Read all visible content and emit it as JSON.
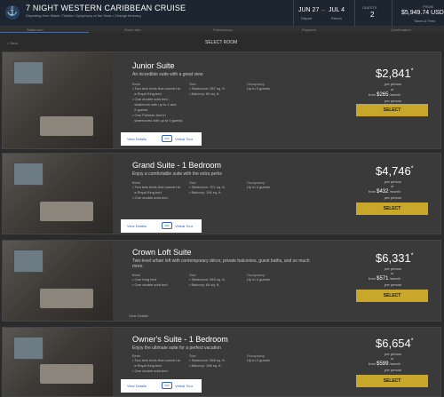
{
  "header": {
    "title": "7 NIGHT WESTERN CARIBBEAN CRUISE",
    "subtitle": "Departing from Miami, Florida • Symphony of the Seas • Change Itinerary",
    "depart_date": "JUN 27",
    "return_date": "JUL 4",
    "depart_label": "Depart",
    "return_label": "Return",
    "guests_label": "GUESTS",
    "guests_value": "2",
    "price_label": "FROM",
    "price_value": "$5,949.74 USD",
    "price_note": "Taxes & Fees"
  },
  "steps": [
    "Stateroom",
    "Room Info",
    "Preferences",
    "Payment",
    "Confirmation"
  ],
  "nav": {
    "back": "< Back",
    "page_title": "SELECT ROOM"
  },
  "labels": {
    "beds": "Beds",
    "size": "Size",
    "occupancy": "Occupancy",
    "view_details": "View Details",
    "virtual_tour": "Virtual Tour",
    "select": "SELECT",
    "or": "or",
    "from": "from",
    "month": "/month",
    "per_person": "per person"
  },
  "rooms": [
    {
      "name": "Junior Suite",
      "desc": "An incredible suite with a great view",
      "beds": [
        "Two twin beds that convert to",
        "a Royal King bed",
        "One double sofa bed -",
        "stateroom with up to 4 and",
        "5 guests",
        "One Pullman bed in",
        "staterooms with up to 5 guests"
      ],
      "size": [
        "Stateroom: 287 sq. ft.",
        "Balcony: 80 sq. ft."
      ],
      "occupancy": "Up to 5 guests",
      "price": "$2,841",
      "monthly": "$265"
    },
    {
      "name": "Grand Suite - 1 Bedroom",
      "desc": "Enjoy a comfortable suite with the extra perks",
      "beds": [
        "Two twin beds that convert to",
        "a Royal King bed",
        "One double sofa bed"
      ],
      "size": [
        "Stateroom: 371 sq. ft.",
        "Balcony: 106 sq. ft."
      ],
      "occupancy": "Up to 4 guests",
      "price": "$4,746",
      "monthly": "$432"
    },
    {
      "name": "Crown Loft Suite",
      "desc": "Two-level urban loft with contemporary décor, private balconies, guest baths, and so much more.",
      "beds": [
        "One King bed",
        "One double sofa bed"
      ],
      "size": [
        "Stateroom: 545 sq. ft.",
        "Balcony: 84 sq. ft."
      ],
      "occupancy": "Up to 4 guests",
      "price": "$6,331",
      "monthly": "$571"
    },
    {
      "name": "Owner's Suite - 1 Bedroom",
      "desc": "Enjoy the ultimate suite for a perfect vacation",
      "beds": [
        "Two twin beds that convert to",
        "a Royal King bed",
        "One double sofa bed"
      ],
      "size": [
        "Stateroom: 558 sq. ft.",
        "Balcony: 106 sq. ft."
      ],
      "occupancy": "Up to 4 guests",
      "price": "$6,654",
      "monthly": "$599"
    }
  ]
}
